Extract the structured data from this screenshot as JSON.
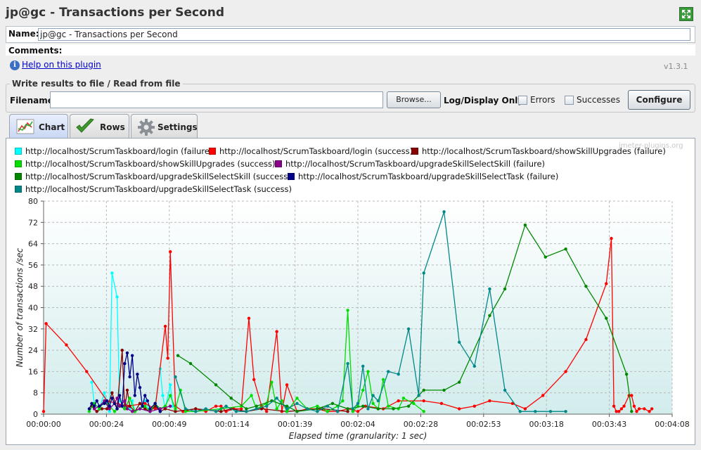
{
  "window": {
    "title": "jp@gc - Transactions per Second"
  },
  "form": {
    "name_label": "Name:",
    "name_value": "jp@gc - Transactions per Second",
    "comments_label": "Comments:",
    "help_link": "Help on this plugin",
    "version": "v1.3.1"
  },
  "file_section": {
    "legend": "Write results to file / Read from file",
    "filename_label": "Filename",
    "filename_value": "",
    "browse_button": "Browse...",
    "log_display_label": "Log/Display Only:",
    "errors_label": "Errors",
    "successes_label": "Successes",
    "configure_button": "Configure"
  },
  "tabs": [
    {
      "label": "Chart",
      "icon": "chart-icon",
      "active": true
    },
    {
      "label": "Rows",
      "icon": "checkmark-icon",
      "active": false
    },
    {
      "label": "Settings",
      "icon": "gear-icon",
      "active": false
    }
  ],
  "watermark": "jmeter-plugins.org",
  "chart_data": {
    "type": "line",
    "xlabel": "Elapsed time (granularity: 1 sec)",
    "ylabel": "Number of transactions /sec",
    "ylim": [
      0,
      80
    ],
    "xlim": [
      0,
      248
    ],
    "yticks": [
      0,
      8,
      16,
      24,
      32,
      40,
      48,
      56,
      64,
      72,
      80
    ],
    "xticks": [
      "00:00:00",
      "00:00:24",
      "00:00:49",
      "00:01:14",
      "00:01:39",
      "00:02:04",
      "00:02:28",
      "00:02:53",
      "00:03:18",
      "00:03:43",
      "00:04:08"
    ],
    "xtick_values": [
      0,
      24.8,
      49.6,
      74.4,
      99.2,
      124,
      148.8,
      173.6,
      198.4,
      223.2,
      248
    ],
    "grid": true,
    "legend_position": "top",
    "series": [
      {
        "name": "http://localhost/ScrumTaskboard/login (failure)",
        "color": "#00ffff",
        "points": [
          [
            19,
            12
          ],
          [
            20,
            4
          ],
          [
            22,
            2
          ],
          [
            24,
            8
          ],
          [
            26,
            1
          ],
          [
            27,
            53
          ],
          [
            29,
            44
          ],
          [
            30,
            5
          ],
          [
            32,
            3
          ],
          [
            34,
            2
          ],
          [
            35,
            5
          ],
          [
            36,
            1
          ],
          [
            38,
            2
          ],
          [
            40,
            5
          ],
          [
            42,
            1
          ],
          [
            44,
            3
          ],
          [
            46,
            17
          ],
          [
            47,
            7
          ],
          [
            48,
            2
          ],
          [
            50,
            11
          ],
          [
            51,
            3
          ]
        ]
      },
      {
        "name": "http://localhost/ScrumTaskboard/login (success)",
        "color": "#ff0000",
        "points": [
          [
            0,
            1
          ],
          [
            1,
            34
          ],
          [
            9,
            26
          ],
          [
            17,
            16
          ],
          [
            25,
            5
          ],
          [
            33,
            3
          ],
          [
            40,
            4
          ],
          [
            44,
            2
          ],
          [
            48,
            33
          ],
          [
            49,
            21
          ],
          [
            50,
            61
          ],
          [
            52,
            3
          ],
          [
            55,
            1
          ],
          [
            60,
            2
          ],
          [
            64,
            1
          ],
          [
            68,
            3
          ],
          [
            70,
            3
          ],
          [
            72,
            1
          ],
          [
            75,
            2
          ],
          [
            78,
            2
          ],
          [
            81,
            36
          ],
          [
            83,
            13
          ],
          [
            86,
            3
          ],
          [
            88,
            1
          ],
          [
            92,
            31
          ],
          [
            94,
            1
          ],
          [
            96,
            11
          ],
          [
            100,
            1
          ],
          [
            104,
            2
          ],
          [
            108,
            2
          ],
          [
            112,
            1
          ],
          [
            116,
            1
          ],
          [
            120,
            2
          ],
          [
            124,
            1
          ],
          [
            127,
            3
          ],
          [
            134,
            2
          ],
          [
            140,
            5
          ],
          [
            150,
            5
          ],
          [
            157,
            4
          ],
          [
            164,
            2
          ],
          [
            170,
            3
          ],
          [
            176,
            5
          ],
          [
            185,
            4
          ],
          [
            190,
            2
          ],
          [
            197,
            7
          ],
          [
            206,
            16
          ],
          [
            214,
            28
          ],
          [
            222,
            49
          ],
          [
            224,
            66
          ],
          [
            225,
            3
          ],
          [
            226,
            1
          ],
          [
            227,
            1
          ],
          [
            228,
            2
          ],
          [
            229,
            3
          ],
          [
            231,
            7
          ],
          [
            232,
            7
          ],
          [
            233,
            3
          ],
          [
            234,
            1
          ],
          [
            235,
            2
          ],
          [
            237,
            2
          ],
          [
            239,
            1
          ],
          [
            240,
            2
          ]
        ]
      },
      {
        "name": "http://localhost/ScrumTaskboard/showSkillUpgrades (failure)",
        "color": "#880000",
        "points": [
          [
            19,
            3
          ],
          [
            21,
            1
          ],
          [
            23,
            2
          ],
          [
            25,
            2
          ],
          [
            27,
            8
          ],
          [
            29,
            2
          ],
          [
            31,
            24
          ],
          [
            32,
            2
          ],
          [
            33,
            9
          ],
          [
            34,
            3
          ],
          [
            36,
            1
          ],
          [
            38,
            4
          ],
          [
            40,
            2
          ],
          [
            42,
            1
          ],
          [
            44,
            3
          ],
          [
            46,
            1
          ],
          [
            48,
            2
          ],
          [
            52,
            1
          ],
          [
            60,
            2
          ],
          [
            70,
            1
          ],
          [
            74,
            2
          ],
          [
            80,
            1
          ],
          [
            86,
            2
          ],
          [
            96,
            1
          ],
          [
            110,
            2
          ],
          [
            120,
            1
          ]
        ]
      },
      {
        "name": "http://localhost/ScrumTaskboard/showSkillUpgrades (success)",
        "color": "#00dd00",
        "points": [
          [
            18,
            1
          ],
          [
            20,
            4
          ],
          [
            22,
            2
          ],
          [
            24,
            5
          ],
          [
            26,
            3
          ],
          [
            28,
            1
          ],
          [
            30,
            3
          ],
          [
            32,
            2
          ],
          [
            34,
            6
          ],
          [
            36,
            1
          ],
          [
            38,
            2
          ],
          [
            40,
            3
          ],
          [
            42,
            1
          ],
          [
            44,
            4
          ],
          [
            46,
            2
          ],
          [
            48,
            3
          ],
          [
            50,
            7
          ],
          [
            52,
            2
          ],
          [
            54,
            9
          ],
          [
            56,
            1
          ],
          [
            60,
            1
          ],
          [
            70,
            2
          ],
          [
            78,
            3
          ],
          [
            82,
            7
          ],
          [
            84,
            2
          ],
          [
            88,
            4
          ],
          [
            90,
            12
          ],
          [
            92,
            2
          ],
          [
            94,
            5
          ],
          [
            96,
            1
          ],
          [
            100,
            6
          ],
          [
            104,
            2
          ],
          [
            108,
            3
          ],
          [
            112,
            1
          ],
          [
            116,
            3
          ],
          [
            118,
            5
          ],
          [
            120,
            39
          ],
          [
            122,
            1
          ],
          [
            124,
            3
          ],
          [
            126,
            9
          ],
          [
            128,
            16
          ],
          [
            130,
            4
          ],
          [
            132,
            2
          ],
          [
            134,
            13
          ],
          [
            136,
            3
          ],
          [
            140,
            2
          ],
          [
            142,
            6
          ],
          [
            146,
            4
          ],
          [
            150,
            1
          ]
        ]
      },
      {
        "name": "http://localhost/ScrumTaskboard/upgradeSkillSelectSkill (failure)",
        "color": "#880088",
        "points": [
          [
            20,
            2
          ],
          [
            22,
            3
          ],
          [
            24,
            5
          ],
          [
            26,
            2
          ],
          [
            28,
            4
          ],
          [
            29,
            6
          ],
          [
            30,
            3
          ],
          [
            32,
            5
          ],
          [
            33,
            2
          ],
          [
            35,
            1
          ],
          [
            38,
            2
          ],
          [
            42,
            1
          ],
          [
            46,
            2
          ],
          [
            50,
            3
          ]
        ]
      },
      {
        "name": "http://localhost/ScrumTaskboard/upgradeSkillSelectSkill (success)",
        "color": "#008800",
        "points": [
          [
            53,
            22
          ],
          [
            58,
            19
          ],
          [
            68,
            11
          ],
          [
            74,
            6
          ],
          [
            80,
            2
          ],
          [
            84,
            3
          ],
          [
            90,
            5
          ],
          [
            96,
            3
          ],
          [
            100,
            1
          ],
          [
            108,
            2
          ],
          [
            114,
            4
          ],
          [
            120,
            2
          ],
          [
            126,
            3
          ],
          [
            132,
            2
          ],
          [
            138,
            2
          ],
          [
            144,
            3
          ],
          [
            150,
            9
          ],
          [
            158,
            9
          ],
          [
            164,
            12
          ],
          [
            176,
            37
          ],
          [
            182,
            47
          ],
          [
            190,
            71
          ],
          [
            198,
            59
          ],
          [
            206,
            62
          ],
          [
            214,
            48
          ],
          [
            222,
            36
          ],
          [
            230,
            15
          ],
          [
            232,
            1
          ]
        ]
      },
      {
        "name": "http://localhost/ScrumTaskboard/upgradeSkillSelectTask (failure)",
        "color": "#000088",
        "points": [
          [
            18,
            2
          ],
          [
            19,
            4
          ],
          [
            20,
            3
          ],
          [
            21,
            5
          ],
          [
            22,
            3
          ],
          [
            24,
            4
          ],
          [
            25,
            5
          ],
          [
            26,
            3
          ],
          [
            27,
            6
          ],
          [
            28,
            4
          ],
          [
            29,
            2
          ],
          [
            30,
            7
          ],
          [
            31,
            3
          ],
          [
            32,
            19
          ],
          [
            33,
            23
          ],
          [
            34,
            14
          ],
          [
            35,
            22
          ],
          [
            36,
            7
          ],
          [
            37,
            15
          ],
          [
            38,
            10
          ],
          [
            39,
            3
          ],
          [
            40,
            7
          ],
          [
            41,
            5
          ],
          [
            42,
            2
          ],
          [
            44,
            4
          ],
          [
            46,
            1
          ]
        ]
      },
      {
        "name": "http://localhost/ScrumTaskboard/upgradeSkillSelectTask (success)",
        "color": "#008888",
        "points": [
          [
            52,
            14
          ],
          [
            56,
            2
          ],
          [
            60,
            1
          ],
          [
            64,
            2
          ],
          [
            68,
            1
          ],
          [
            72,
            3
          ],
          [
            76,
            1
          ],
          [
            80,
            1
          ],
          [
            84,
            2
          ],
          [
            88,
            3
          ],
          [
            92,
            6
          ],
          [
            96,
            2
          ],
          [
            100,
            4
          ],
          [
            104,
            2
          ],
          [
            108,
            1
          ],
          [
            112,
            3
          ],
          [
            116,
            1
          ],
          [
            120,
            19
          ],
          [
            122,
            2
          ],
          [
            124,
            4
          ],
          [
            126,
            18
          ],
          [
            128,
            2
          ],
          [
            130,
            7
          ],
          [
            132,
            5
          ],
          [
            136,
            16
          ],
          [
            140,
            15
          ],
          [
            144,
            32
          ],
          [
            148,
            7
          ],
          [
            150,
            53
          ],
          [
            158,
            76
          ],
          [
            164,
            27
          ],
          [
            170,
            18
          ],
          [
            176,
            47
          ],
          [
            182,
            9
          ],
          [
            188,
            1
          ],
          [
            194,
            1
          ],
          [
            200,
            1
          ],
          [
            206,
            1
          ]
        ]
      }
    ]
  }
}
